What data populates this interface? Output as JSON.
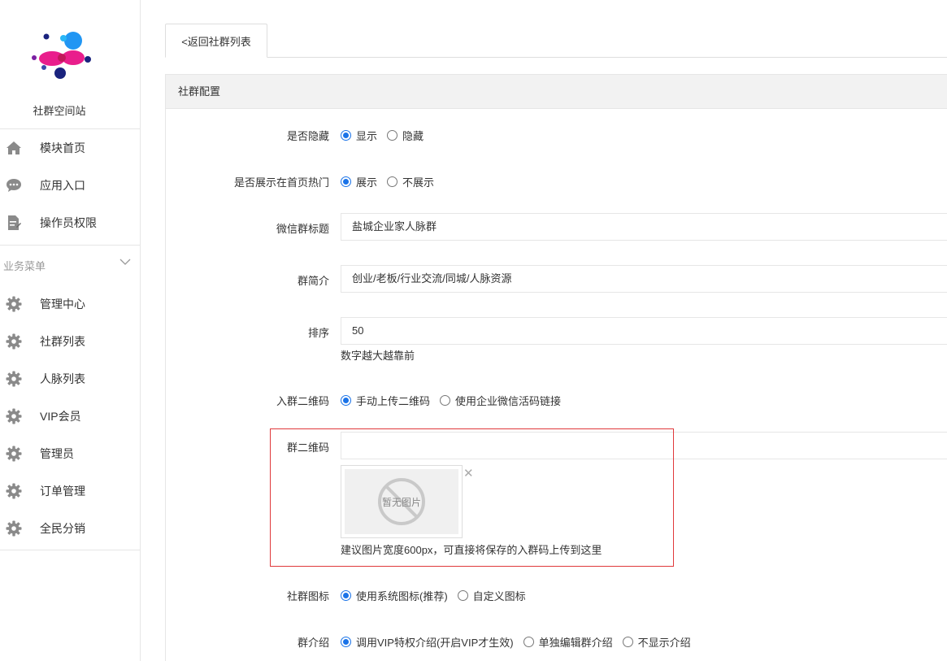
{
  "sidebar": {
    "site_name": "社群空间站",
    "top_items": [
      {
        "label": "模块首页",
        "icon": "home-icon"
      },
      {
        "label": "应用入口",
        "icon": "chat-icon"
      },
      {
        "label": "操作员权限",
        "icon": "document-edit-icon"
      }
    ],
    "section_title": "业务菜单",
    "section_items": [
      {
        "label": "管理中心",
        "icon": "gear-icon"
      },
      {
        "label": "社群列表",
        "icon": "gear-icon"
      },
      {
        "label": "人脉列表",
        "icon": "gear-icon"
      },
      {
        "label": "VIP会员",
        "icon": "gear-icon"
      },
      {
        "label": "管理员",
        "icon": "gear-icon"
      },
      {
        "label": "订单管理",
        "icon": "gear-icon"
      },
      {
        "label": "全民分销",
        "icon": "gear-icon"
      }
    ]
  },
  "tab": {
    "back_label": "<返回社群列表"
  },
  "panel": {
    "title": "社群配置"
  },
  "form": {
    "hidden": {
      "label": "是否隐藏",
      "options": [
        "显示",
        "隐藏"
      ],
      "selected": 0
    },
    "hot": {
      "label": "是否展示在首页热门",
      "options": [
        "展示",
        "不展示"
      ],
      "selected": 0
    },
    "wechat_title": {
      "label": "微信群标题",
      "value": "盐城企业家人脉群"
    },
    "intro_short": {
      "label": "群简介",
      "value": "创业/老板/行业交流/同城/人脉资源"
    },
    "sort": {
      "label": "排序",
      "value": "50",
      "hint": "数字越大越靠前"
    },
    "qr_mode": {
      "label": "入群二维码",
      "options": [
        "手动上传二维码",
        "使用企业微信活码链接"
      ],
      "selected": 0
    },
    "qr_code": {
      "label": "群二维码",
      "value": "",
      "placeholder_text": "暂无图片",
      "hint": "建议图片宽度600px，可直接将保存的入群码上传到这里"
    },
    "group_icon": {
      "label": "社群图标",
      "options": [
        "使用系统图标(推荐)",
        "自定义图标"
      ],
      "selected": 0
    },
    "group_intro": {
      "label": "群介绍",
      "options": [
        "调用VIP特权介绍(开启VIP才生效)",
        "单独编辑群介绍",
        "不显示介绍"
      ],
      "selected": 0
    }
  },
  "colors": {
    "accent": "#1a73e8",
    "highlight_border": "#e0393b"
  }
}
